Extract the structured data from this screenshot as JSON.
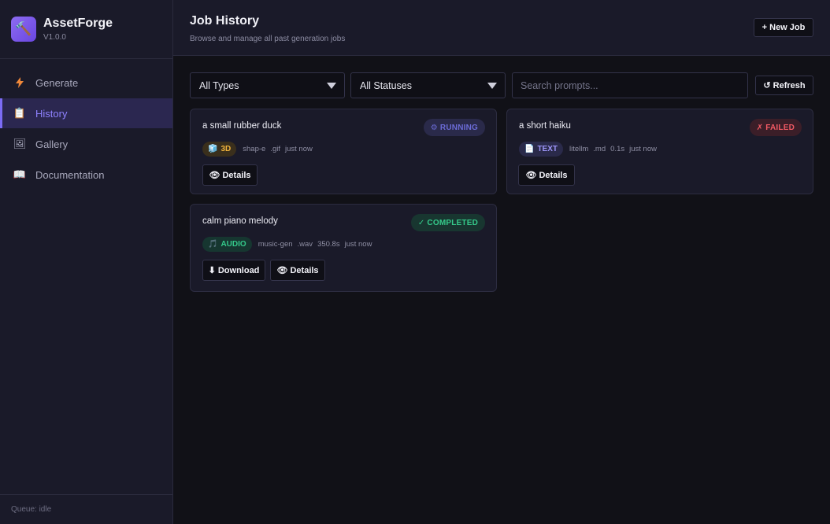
{
  "app": {
    "name": "AssetForge",
    "version": "V1.0.0",
    "logo_icon": "hammer-icon"
  },
  "sidebar": {
    "items": [
      {
        "label": "Generate",
        "icon": "lightning-icon",
        "active": false
      },
      {
        "label": "History",
        "icon": "clipboard-icon",
        "active": true
      },
      {
        "label": "Gallery",
        "icon": "picture-icon",
        "active": false
      },
      {
        "label": "Documentation",
        "icon": "book-icon",
        "active": false
      }
    ],
    "footer": "Queue: idle"
  },
  "header": {
    "title": "Job History",
    "subtitle": "Browse and manage all past generation jobs",
    "new_job_label": "+ New Job"
  },
  "filters": {
    "type_value": "All Types",
    "status_value": "All Statuses",
    "search_placeholder": "Search prompts...",
    "refresh_label": "↺ Refresh"
  },
  "jobs": [
    {
      "prompt": "a small rubber duck",
      "status": "⚙ RUNNING",
      "type": "3D",
      "model": "shap-e",
      "format": ".gif",
      "duration": "",
      "time": "just now",
      "actions": [
        "👁 Details"
      ]
    },
    {
      "prompt": "a short haiku",
      "status": "✗ FAILED",
      "type": "TEXT",
      "model": "litellm",
      "format": ".md",
      "duration": "0.1s",
      "time": "just now",
      "actions": [
        "👁 Details"
      ]
    },
    {
      "prompt": "calm piano melody",
      "status": "✓ COMPLETED",
      "type": "AUDIO",
      "model": "music-gen",
      "format": ".wav",
      "duration": "350.8s",
      "time": "just now",
      "actions": [
        "⬇ Download",
        "👁 Details"
      ]
    }
  ],
  "colors": {
    "accent": "#7c6cf5",
    "running": "#6b6bd6",
    "failed": "#f15a64",
    "completed": "#35c98a"
  }
}
